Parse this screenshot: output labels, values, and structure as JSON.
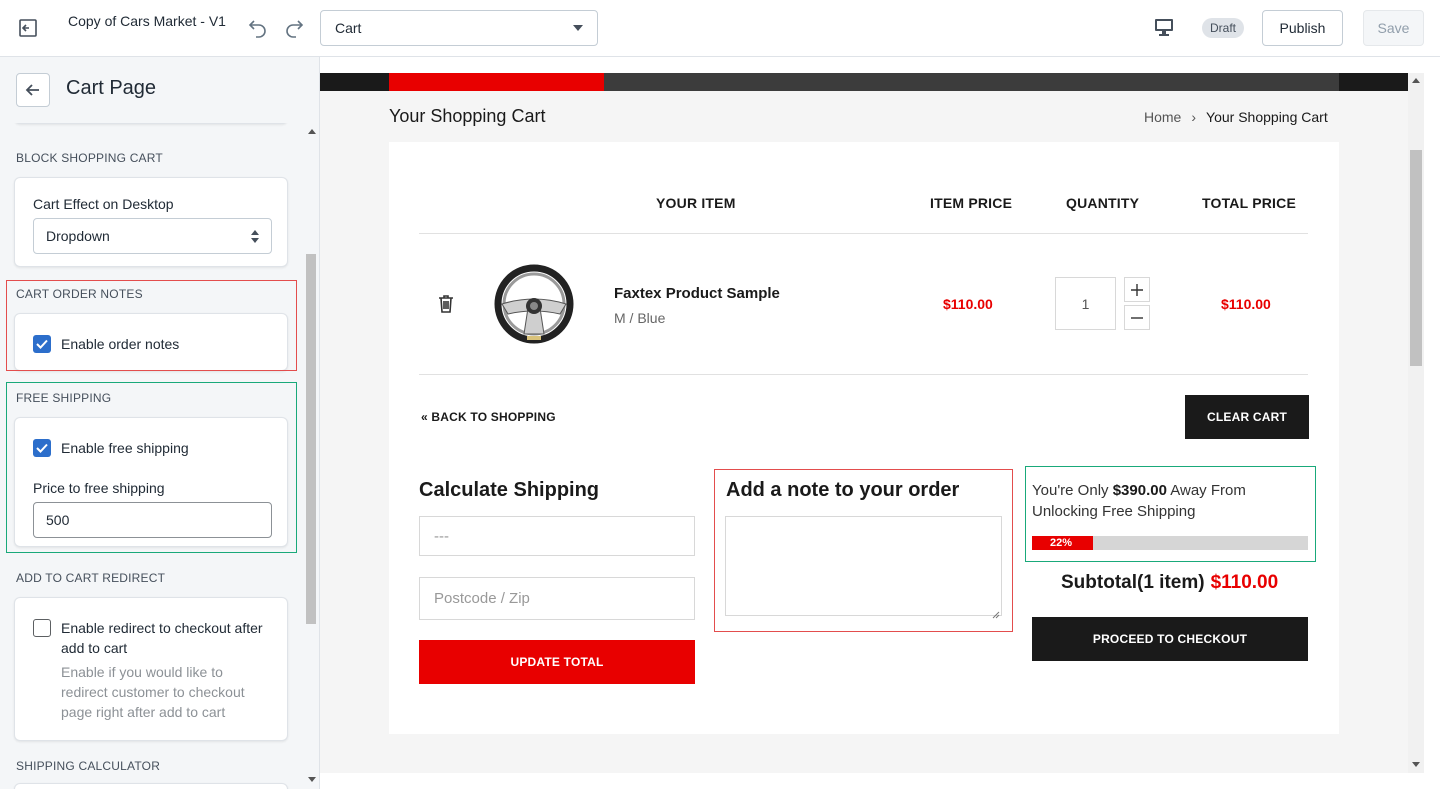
{
  "topbar": {
    "title": "Copy of Cars Market - V1",
    "page_select": "Cart",
    "draft_badge": "Draft",
    "publish_label": "Publish",
    "save_label": "Save"
  },
  "sidebar": {
    "title": "Cart Page",
    "sections": {
      "block_shopping_cart": {
        "label": "BLOCK SHOPPING CART",
        "field_label": "Cart Effect on Desktop",
        "value": "Dropdown"
      },
      "cart_order_notes": {
        "label": "CART ORDER NOTES",
        "checkbox_label": "Enable order notes",
        "checked": true
      },
      "free_shipping": {
        "label": "FREE SHIPPING",
        "checkbox_label": "Enable free shipping",
        "checked": true,
        "price_label": "Price to free shipping",
        "price_value": "500"
      },
      "add_to_cart_redirect": {
        "label": "ADD TO CART REDIRECT",
        "checkbox_label": "Enable redirect to checkout after add to cart",
        "checked": false,
        "help": "Enable if you would like to redirect customer to checkout page right after add to cart"
      },
      "shipping_calculator": {
        "label": "SHIPPING CALCULATOR"
      }
    }
  },
  "preview": {
    "cart_title": "Your Shopping Cart",
    "breadcrumb": {
      "home": "Home",
      "separator": "›",
      "current": "Your Shopping Cart"
    },
    "table_headers": {
      "item": "YOUR ITEM",
      "price": "ITEM PRICE",
      "quantity": "QUANTITY",
      "total": "TOTAL PRICE"
    },
    "item": {
      "name": "Faxtex Product Sample",
      "variant": "M / Blue",
      "price": "$110.00",
      "quantity": "1",
      "total": "$110.00"
    },
    "back_to_shopping": "« BACK TO SHOPPING",
    "clear_cart": "CLEAR CART",
    "calc_shipping": {
      "title": "Calculate Shipping",
      "country_placeholder": "---",
      "zip_placeholder": "Postcode / Zip",
      "update_label": "UPDATE TOTAL"
    },
    "order_note": {
      "title": "Add a note to your order"
    },
    "free_shipping": {
      "prefix": "You're Only ",
      "amount": "$390.00",
      "suffix": " Away From Unlocking Free Shipping",
      "progress_percent": 22,
      "progress_label": "22%"
    },
    "subtotal": {
      "label": "Subtotal(1 item)",
      "amount": "$110.00"
    },
    "checkout_label": "PROCEED TO CHECKOUT"
  },
  "colors": {
    "accent_red": "#e80000",
    "dark": "#1a1a1a",
    "checkbox_blue": "#2c6ecb",
    "highlight_red": "#e34d4d",
    "highlight_green": "#19a97a"
  }
}
